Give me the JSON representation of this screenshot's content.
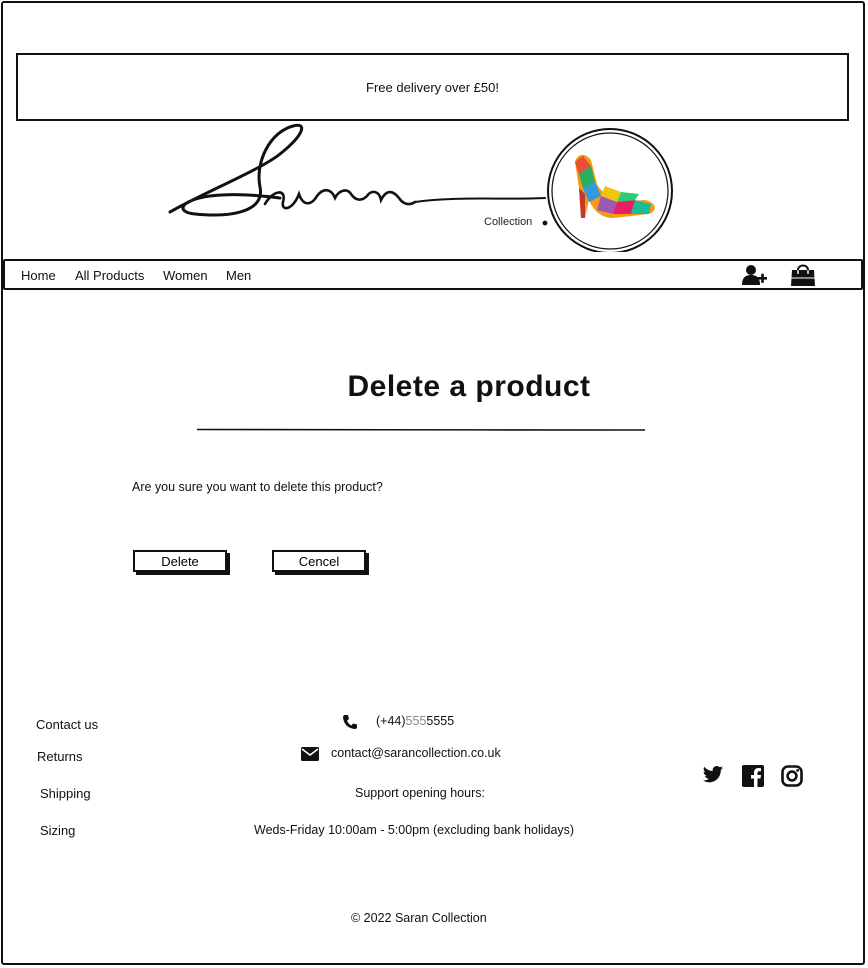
{
  "banner": {
    "text": "Free delivery over £50!"
  },
  "logo": {
    "brand": "Saran",
    "sub": "Collection"
  },
  "nav": {
    "items": [
      "Home",
      "All Products",
      "Women",
      "Men"
    ],
    "icons": [
      "add-user-icon",
      "shopping-bag-icon"
    ]
  },
  "main": {
    "title": "Delete a product",
    "question": "Are you sure you want to delete this product?",
    "delete_label": "Delete",
    "cancel_label": "Cencel"
  },
  "footer": {
    "links": [
      "Contact us",
      "Returns",
      "Shipping",
      "Sizing"
    ],
    "phone_prefix": "(+44)",
    "phone_mid": "555",
    "phone_suffix": "5555",
    "email": "contact@sarancollection.co.uk",
    "hours_title": "Support opening hours:",
    "hours": "Weds-Friday 10:00am - 5:00pm (excluding bank holidays)",
    "social": [
      "twitter-icon",
      "facebook-icon",
      "instagram-icon"
    ],
    "copyright": "© 2022 Saran Collection"
  },
  "colors": {
    "ink": "#111111",
    "muted": "#8a8797"
  }
}
